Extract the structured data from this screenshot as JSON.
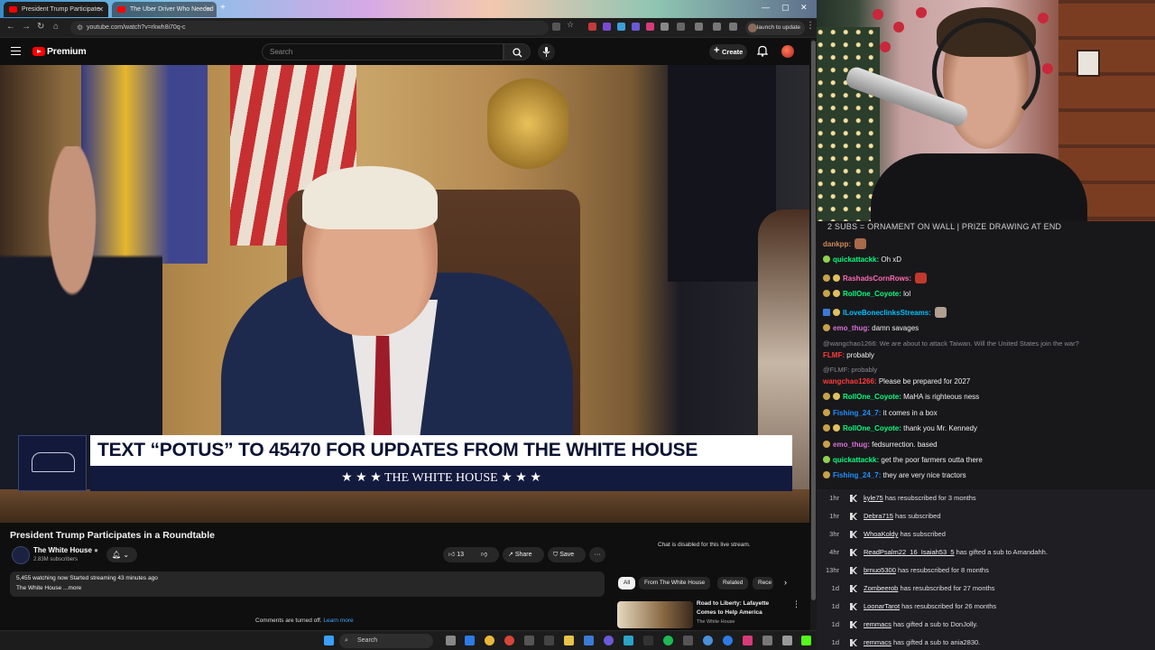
{
  "browser": {
    "tabs": [
      {
        "label": "President Trump Participate"
      },
      {
        "label": "The Uber Driver Who Needed"
      }
    ],
    "url": "youtube.com/watch?v=rkwh8i70q-c",
    "relaunch_label": "Relaunch to update"
  },
  "youtube": {
    "logo_text": "Premium",
    "search_placeholder": "Search",
    "create_label": "Create",
    "banner_top": "TEXT “POTUS” TO 45470 FOR UPDATES FROM THE WHITE HOUSE",
    "banner_bottom": "★ ★ ★  THE WHITE HOUSE  ★ ★ ★",
    "video_title": "President Trump Participates in a Roundtable",
    "channel_name": "The White House",
    "channel_subs": "2.83M subscribers",
    "likes": "13",
    "share_label": "Share",
    "save_label": "Save",
    "more_label": "···",
    "desc_stats": "5,455 watching now  Started streaming 43 minutes ago",
    "desc_text": "The White House ...more",
    "comments_off": "Comments are turned off.",
    "learn_more": "Learn more",
    "chat_disabled": "Chat is disabled for this live stream.",
    "chips": [
      "All",
      "From The White House",
      "Related",
      "Rece"
    ],
    "rec_title": "Road to Liberty: Lafayette Comes to Help America",
    "rec_channel": "The White House"
  },
  "stream": {
    "chat_title": "2 SUBS = ORNAMENT ON WALL | PRIZE DRAWING AT END",
    "messages": [
      {
        "user": "dankpp:",
        "text": "",
        "color": "#d08a55"
      },
      {
        "user": "quickattackk:",
        "text": "Oh xD",
        "color": "#00ff7f"
      },
      {
        "user": "RashadsCornRows:",
        "text": "",
        "color": "#ff69b4"
      },
      {
        "user": "RollOne_Coyote:",
        "text": "lol",
        "color": "#00ff7f"
      },
      {
        "user": "ILoveBoneclinksStreams:",
        "text": "",
        "color": "#00bfff"
      },
      {
        "user": "emo_thug:",
        "text": "damn savages",
        "color": "#da70d6"
      },
      {
        "user": "FLMF:",
        "text": "probably",
        "color": "#ff3b3b"
      },
      {
        "user": "wangchao1266:",
        "text": "Please be prepared for 2027",
        "color": "#ff3b3b"
      },
      {
        "user": "RollOne_Coyote:",
        "text": "MaHA is righteous ness",
        "color": "#00ff7f"
      },
      {
        "user": "Fishing_24_7:",
        "text": "it comes in a box",
        "color": "#1e90ff"
      },
      {
        "user": "RollOne_Coyote:",
        "text": "thank you Mr. Kennedy",
        "color": "#00ff7f"
      },
      {
        "user": "emo_thug:",
        "text": "fedsurrection. based",
        "color": "#da70d6"
      },
      {
        "user": "quickattackk:",
        "text": "get the poor farmers outta there",
        "color": "#00ff7f"
      },
      {
        "user": "Fishing_24_7:",
        "text": "they are very nice tractors",
        "color": "#1e90ff"
      }
    ],
    "replies": [
      "@wangchao1266: We are about to attack Taiwan. Will the United States join the war?",
      "@FLMF: probably"
    ],
    "events": [
      {
        "time": "1hr",
        "user": "kyle75",
        "text": "has resubscribed for 3 months"
      },
      {
        "time": "1hr",
        "user": "Debra715",
        "text": "has subscribed"
      },
      {
        "time": "3hr",
        "user": "WhoaKoldy",
        "text": "has subscribed"
      },
      {
        "time": "4hr",
        "user": "ReadPsalm22_16_Isaiah53_5",
        "text": "has gifted a sub to Amandahh."
      },
      {
        "time": "13hr",
        "user": "brnuo5300",
        "text": "has resubscribed for 8 months"
      },
      {
        "time": "1d",
        "user": "Zombeerob",
        "text": "has resubscribed for 27 months"
      },
      {
        "time": "1d",
        "user": "LoonarTarot",
        "text": "has resubscribed for 26 months"
      },
      {
        "time": "1d",
        "user": "remmacs",
        "text": "has gifted a sub to DonJolly."
      },
      {
        "time": "1d",
        "user": "remmacs",
        "text": "has gifted a sub to ania2830."
      }
    ]
  },
  "taskbar": {
    "search_label": "Search"
  }
}
